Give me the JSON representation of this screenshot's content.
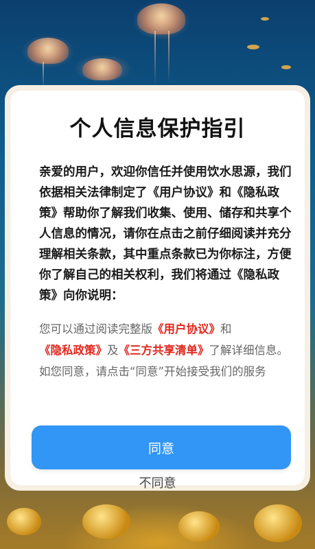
{
  "dialog": {
    "title": "个人信息保护指引",
    "intro": "亲爱的用户，欢迎你信任并使用饮水思源，我们依据相关法律制定了《用户协议》和《隐私政策》帮助你了解我们收集、使用、储存和共享个人信息的情况，请你在点击之前仔细阅读并充分理解相关条款，其中重点条款已为你标注，方便你了解自己的相关权利，我们将通过《隐私政策》向你说明：",
    "secondary": {
      "prefix": "您可以通过阅读完整版",
      "user_agreement_link": "《用户协议》",
      "and_text": "和",
      "privacy_policy_link": "《隐私政策》",
      "also_text": "及",
      "third_party_link": "《三方共享清单》",
      "suffix": "了解详细信息。如您同意，请点击“同意”开始接受我们的服务"
    },
    "agree_label": "同意",
    "disagree_label": "不同意"
  },
  "colors": {
    "accent_button": "#3296f6",
    "link_red": "#e0281e"
  }
}
